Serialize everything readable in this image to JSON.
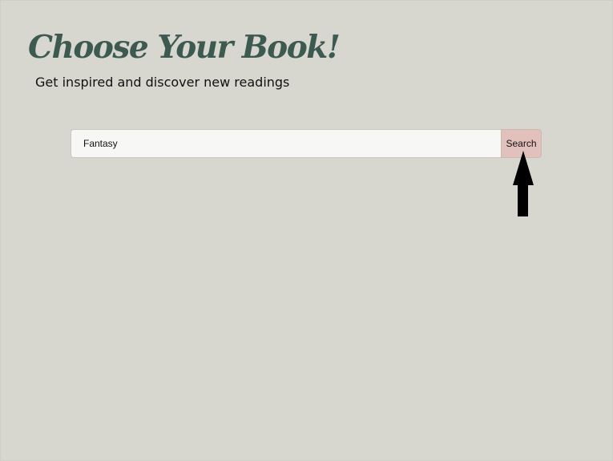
{
  "header": {
    "title": "Choose Your Book!",
    "subtitle": "Get inspired and discover new readings"
  },
  "search": {
    "value": "Fantasy",
    "button_label": "Search"
  },
  "annotation": {
    "icon": "arrow-up-icon",
    "color": "#000000"
  },
  "colors": {
    "background": "#d7d6cf",
    "title": "#3d5a51",
    "input_background": "#f7f7f5",
    "button_background": "#e2c1bd"
  }
}
